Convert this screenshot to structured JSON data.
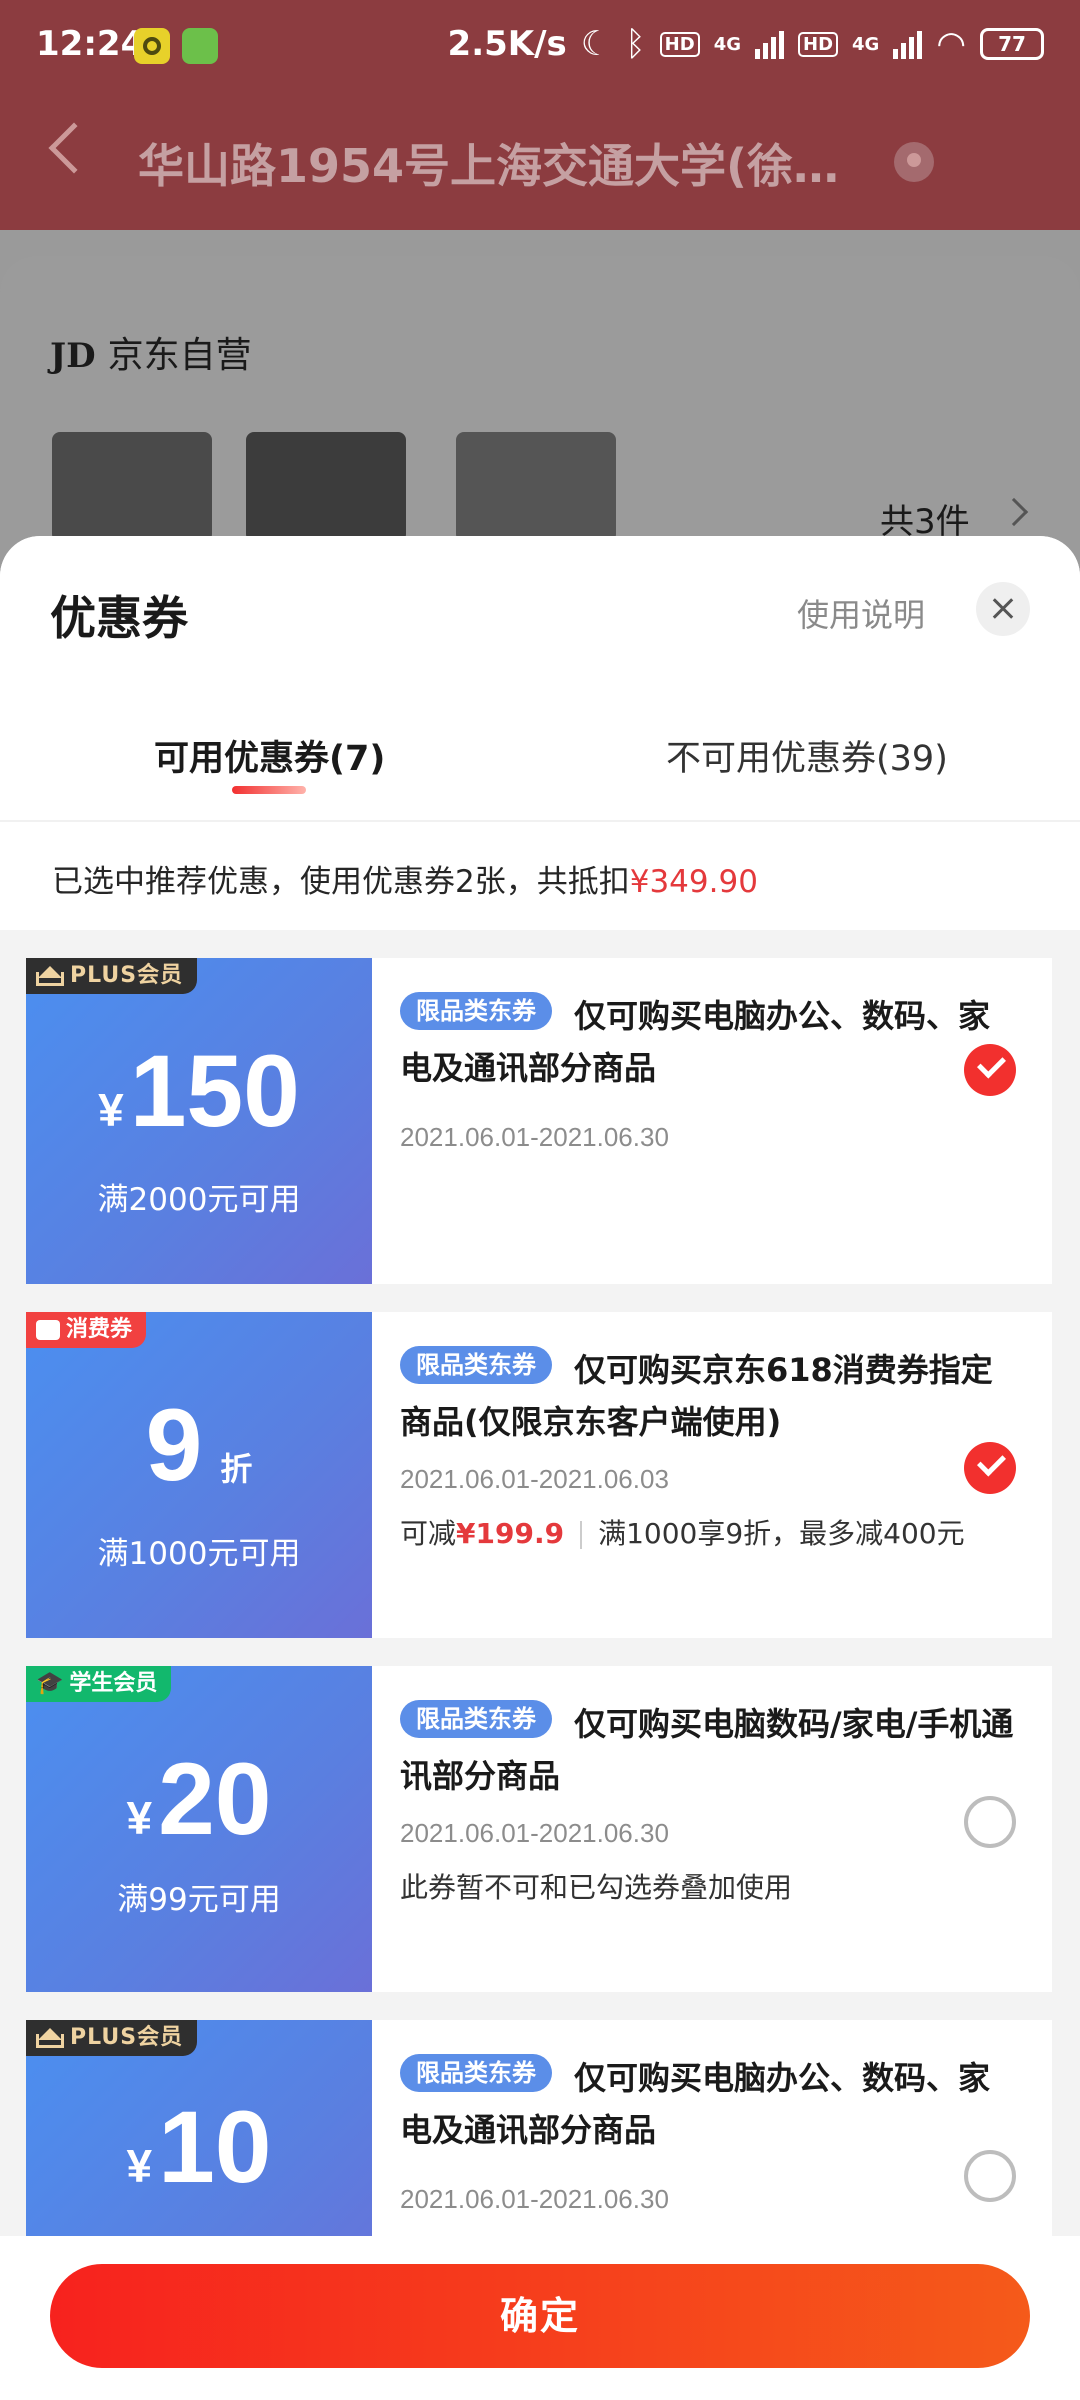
{
  "status_bar": {
    "time": "12:24",
    "net_speed": "2.5K/s",
    "sig1_label": "HD",
    "sig1_net": "4G",
    "sig2_label": "HD",
    "sig2_net": "4G",
    "battery": "77"
  },
  "nav": {
    "title": "华山路1954号上海交通大学(徐…"
  },
  "order_bg": {
    "shop_logo": "JD",
    "shop_name": "京东自营",
    "count": "共3件"
  },
  "sheet": {
    "title": "优惠券",
    "help": "使用说明",
    "tabs": [
      {
        "label": "可用优惠券(7)"
      },
      {
        "label": "不可用优惠券(39)"
      }
    ],
    "summary": {
      "text": "已选中推荐优惠，使用优惠券2张，共抵扣",
      "amount": "¥349.90"
    }
  },
  "coupons": [
    {
      "badge": "PLUS会员",
      "currency": "¥",
      "value": "150",
      "condition": "满2000元可用",
      "tag": "限品类东券",
      "desc": "仅可购买电脑办公、数码、家电及通讯部分商品",
      "date": "2021.06.01-2021.06.30",
      "checked": true
    },
    {
      "badge": "消费券",
      "value": "9",
      "unit": "折",
      "condition": "满1000元可用",
      "tag": "限品类东券",
      "desc": "仅可购买京东618消费券指定商品(仅限京东客户端使用)",
      "date": "2021.06.01-2021.06.03",
      "note_prefix": "可减",
      "note_amount": "¥199.9",
      "note_rest": "满1000享9折，最多减400元",
      "checked": true
    },
    {
      "badge": "学生会员",
      "currency": "¥",
      "value": "20",
      "condition": "满99元可用",
      "tag": "限品类东券",
      "desc": "仅可购买电脑数码/家电/手机通讯部分商品",
      "date": "2021.06.01-2021.06.30",
      "note": "此券暂不可和已勾选券叠加使用",
      "checked": false
    },
    {
      "badge": "PLUS会员",
      "currency": "¥",
      "value": "10",
      "tag": "限品类东券",
      "desc": "仅可购买电脑办公、数码、家电及通讯部分商品",
      "date": "2021.06.01-2021.06.30",
      "checked": false
    }
  ],
  "footer": {
    "confirm": "确定"
  },
  "colors": {
    "brand_red": "#f2302e",
    "coupon_blue": "#5a7fe0",
    "plus_gold": "#efd3a1",
    "student_green": "#12b86d"
  }
}
